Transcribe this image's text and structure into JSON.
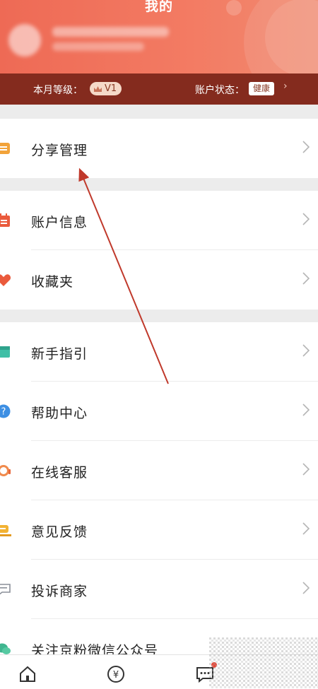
{
  "header": {
    "title": "我的"
  },
  "level_bar": {
    "month_level_label": "本月等级：",
    "level_value": "V1",
    "account_status_label": "账户状态：",
    "account_status_value": "健康"
  },
  "menu_groups": [
    {
      "items": [
        {
          "label": "分享管理",
          "icon": "share-manage-icon"
        }
      ]
    },
    {
      "items": [
        {
          "label": "账户信息",
          "icon": "account-info-icon"
        },
        {
          "label": "收藏夹",
          "icon": "favorites-icon"
        }
      ]
    },
    {
      "items": [
        {
          "label": "新手指引",
          "icon": "guide-icon"
        },
        {
          "label": "帮助中心",
          "icon": "help-icon"
        },
        {
          "label": "在线客服",
          "icon": "customer-service-icon"
        },
        {
          "label": "意见反馈",
          "icon": "feedback-icon"
        },
        {
          "label": "投诉商家",
          "icon": "complaint-icon"
        },
        {
          "label": "关注京粉微信公众号",
          "icon": "wechat-icon"
        }
      ]
    }
  ],
  "tabbar": {
    "tabs": [
      "home-icon",
      "yuan-icon",
      "message-icon"
    ]
  },
  "colors": {
    "header": "#ee6a55",
    "level_bar": "#842b1e",
    "arrow": "#c0392b"
  }
}
